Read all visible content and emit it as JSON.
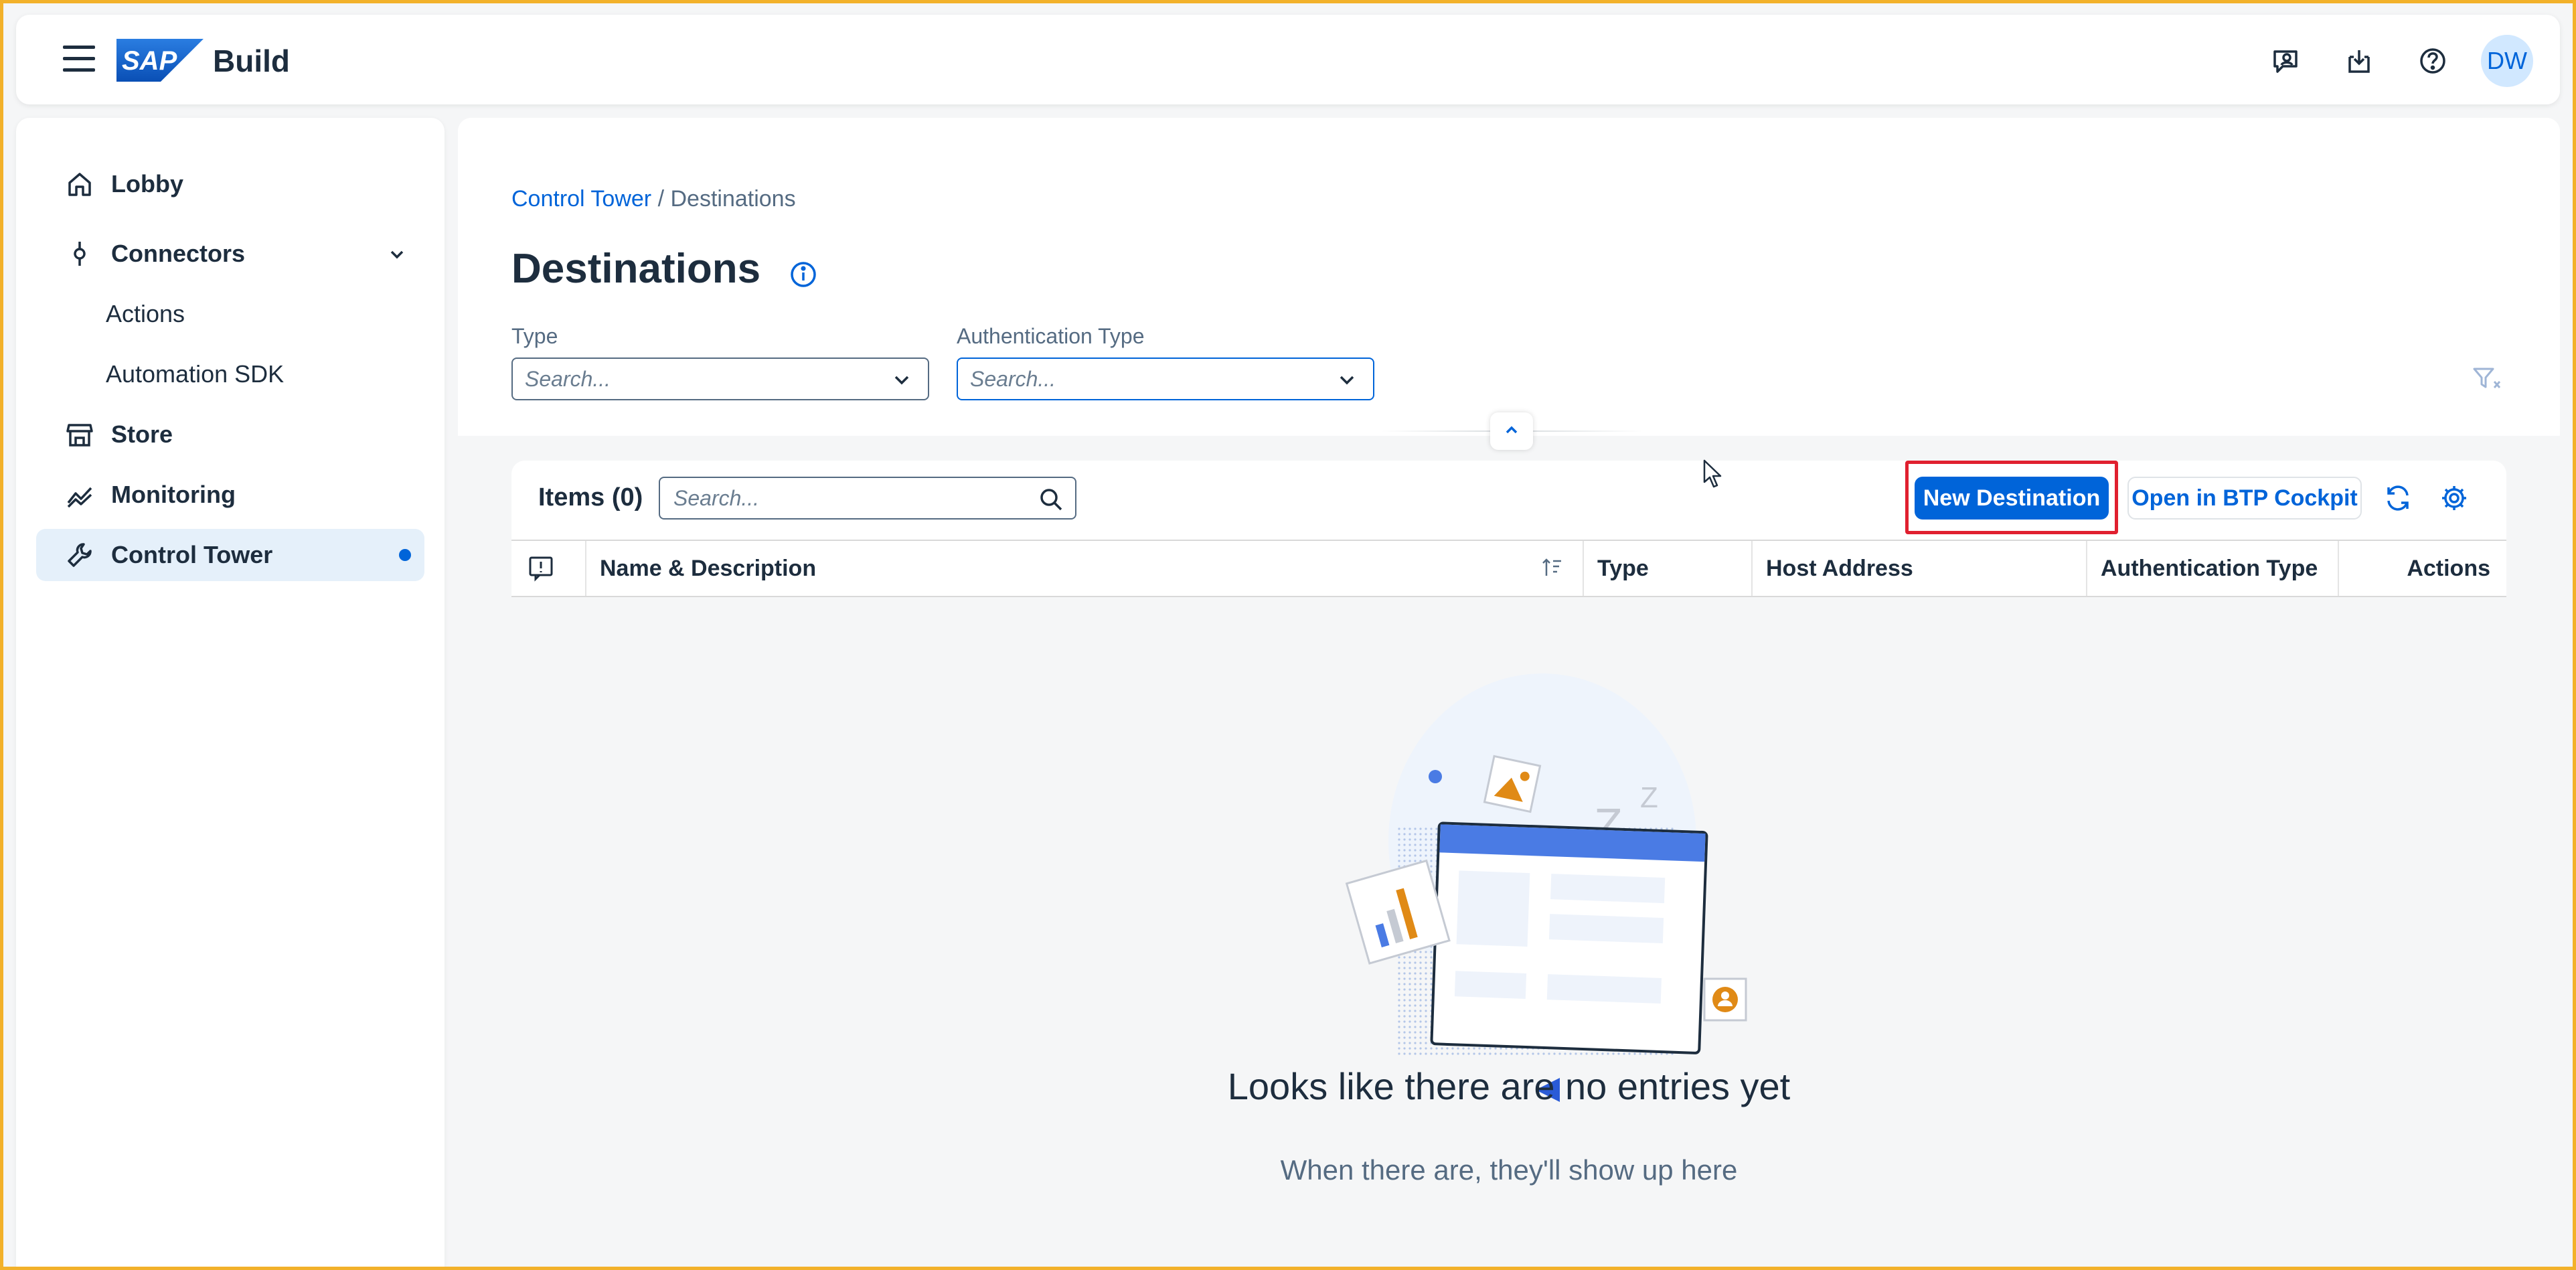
{
  "shell": {
    "logo_text": "SAP",
    "product_name": "Build",
    "avatar_initials": "DW",
    "icons": [
      "feedback-icon",
      "inbox-download-icon",
      "help-icon"
    ]
  },
  "sidenav": {
    "items": [
      {
        "label": "Lobby",
        "icon": "home-icon"
      },
      {
        "label": "Connectors",
        "icon": "connector-icon",
        "expanded": true
      },
      {
        "label": "Actions"
      },
      {
        "label": "Automation SDK"
      },
      {
        "label": "Store",
        "icon": "store-icon"
      },
      {
        "label": "Monitoring",
        "icon": "monitoring-icon"
      },
      {
        "label": "Control Tower",
        "icon": "wrench-icon",
        "selected": true
      }
    ]
  },
  "breadcrumb": {
    "link": "Control Tower",
    "separator": " / ",
    "current": "Destinations"
  },
  "page": {
    "title": "Destinations"
  },
  "filters": {
    "type_label": "Type",
    "type_placeholder": "Search...",
    "auth_label": "Authentication Type",
    "auth_placeholder": "Search..."
  },
  "table": {
    "title": "Items (0)",
    "search_placeholder": "Search...",
    "new_button": "New Destination",
    "cockpit_button": "Open in BTP Cockpit",
    "columns": [
      "Name & Description",
      "Type",
      "Host Address",
      "Authentication Type",
      "Actions"
    ]
  },
  "empty_state": {
    "title": "Looks like there are no entries yet",
    "subtitle": "When there are, they'll show up here"
  },
  "colors": {
    "accent": "#0064d9",
    "highlight": "#e0202f",
    "frame": "#f2b12a"
  }
}
